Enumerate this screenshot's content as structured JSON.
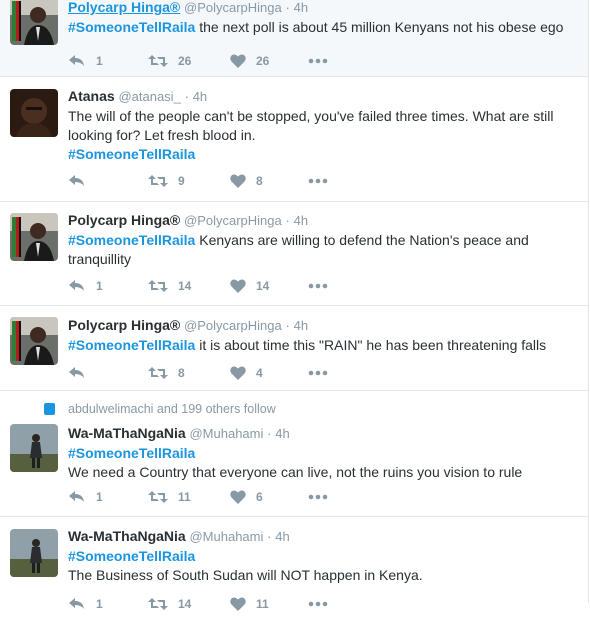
{
  "tweets": [
    {
      "name": "Polycarp Hinga®",
      "handle": "@PolycarpHinga",
      "time": "4h",
      "hashtag": "#SomeoneTellRaila",
      "text": " the next poll is about 45 million Kenyans not his obese ego",
      "reply": "1",
      "retweet": "26",
      "like": "26"
    },
    {
      "name": "Atanas",
      "handle": "@atanasi_",
      "time": "4h",
      "text": "The will of the people can't be stopped, you've failed three times. What are still looking for? Let fresh blood in.",
      "hashtag": "#SomeoneTellRaila",
      "reply": "",
      "retweet": "9",
      "like": "8"
    },
    {
      "name": "Polycarp Hinga®",
      "handle": "@PolycarpHinga",
      "time": "4h",
      "hashtag": "#SomeoneTellRaila",
      "text": " Kenyans are willing to defend the Nation's peace and tranquillity",
      "reply": "1",
      "retweet": "14",
      "like": "14"
    },
    {
      "name": "Polycarp Hinga®",
      "handle": "@PolycarpHinga",
      "time": "4h",
      "hashtag": "#SomeoneTellRaila",
      "text": " it is about time this \"RAIN\" he has been threatening falls",
      "reply": "",
      "retweet": "8",
      "like": "4"
    },
    {
      "social_context": "abdulwelimachi and 199 others follow",
      "name": "Wa-MaThaNgaNia",
      "handle": "@Muhahami",
      "time": "4h",
      "hashtag": "#SomeoneTellRaila",
      "text": "We need a Country that everyone can live, not the ruins you vision to rule",
      "reply": "1",
      "retweet": "11",
      "like": "6"
    },
    {
      "name": "Wa-MaThaNgaNia",
      "handle": "@Muhahami",
      "time": "4h",
      "hashtag": "#SomeoneTellRaila",
      "text": "The Business of South Sudan will NOT happen in Kenya.",
      "reply": "1",
      "retweet": "14",
      "like": "11"
    }
  ],
  "separator": "·",
  "colors": {
    "link": "#1b95e0",
    "meta": "#8899a6",
    "text": "#292f33"
  }
}
